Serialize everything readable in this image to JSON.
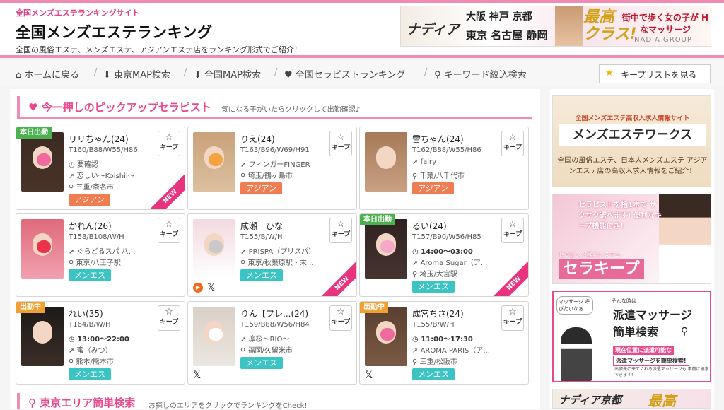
{
  "header": {
    "tagline": "全国メンズエステランキングサイト",
    "title": "全国メンズエステランキング",
    "description": "全国の風俗エステ、メンズエステ、アジアンエステ店をランキング形式でご紹介！"
  },
  "top_banner": {
    "brand": "ナディア",
    "cities_line1": "大阪 神戸 京都",
    "cities_line2": "東京 名古屋 静岡",
    "saiko": "最高",
    "class": "クラス!",
    "copy": "街中で歩く女の子が Hなマッサージ",
    "group": "NADIA GROUP"
  },
  "nav": {
    "items": [
      {
        "icon": "home-icon",
        "label": "ホームに戻る"
      },
      {
        "icon": "download-arrow-icon",
        "label": "東京MAP検索"
      },
      {
        "icon": "download-arrow-icon",
        "label": "全国MAP検索"
      },
      {
        "icon": "heart-icon",
        "label": "全国セラピストランキング"
      },
      {
        "icon": "search-icon",
        "label": "キーワード絞込検索"
      }
    ],
    "keeplist_label": "キープリストを見る"
  },
  "pickup": {
    "title": "今一押しのピックアップセラピスト",
    "subtitle": "気になる子がいたらクリックして出勤確認♪",
    "keep_label": "キープ",
    "new_label": "NEW",
    "cards": [
      {
        "badge": "本日出勤",
        "badge_type": "today",
        "name": "リリちゃん",
        "age": "(24)",
        "size": "T160/B88/W55/H86",
        "time": "要確認",
        "shop": "恋しい〜Koishii〜",
        "area": "三重/斎名市",
        "tag": "アジアン",
        "tag_type": "asian",
        "is_new": true,
        "sns": ""
      },
      {
        "badge": "",
        "badge_type": "",
        "name": "りえ",
        "age": "(24)",
        "size": "T163/B96/W69/H91",
        "time": "",
        "shop": "フィンガーFINGER",
        "area": "埼玉/鶴ヶ島市",
        "tag": "アジアン",
        "tag_type": "asian",
        "is_new": false,
        "sns": ""
      },
      {
        "badge": "",
        "badge_type": "",
        "name": "雪ちゃん",
        "age": "(24)",
        "size": "T162/B88/W55/H86",
        "time": "",
        "shop": "fairy",
        "area": "千葉/八千代市",
        "tag": "アジアン",
        "tag_type": "asian",
        "is_new": false,
        "sns": ""
      },
      {
        "badge": "",
        "badge_type": "",
        "name": "かれん",
        "age": "(26)",
        "size": "T158/B108/W/H",
        "time": "",
        "shop": "ぐらどるスパ 八...",
        "area": "東京/八王子駅",
        "tag": "メンエス",
        "tag_type": "mens",
        "is_new": false,
        "sns": ""
      },
      {
        "badge": "",
        "badge_type": "",
        "name": "成瀬　ひな",
        "age": "",
        "size": "T155/B/W/H",
        "time": "",
        "shop": "PRISPA（プリスパ）",
        "area": "東京/秋葉原駅・末...",
        "tag": "メンエス",
        "tag_type": "mens",
        "is_new": true,
        "sns": "▶ 𝕏"
      },
      {
        "badge": "本日出勤",
        "badge_type": "today",
        "name": "るい",
        "age": "(24)",
        "size": "T157/B90/W56/H85",
        "time": "14:00〜03:00",
        "shop": "Aroma Sugar（ア...",
        "area": "埼玉/大宮駅",
        "tag": "メンエス",
        "tag_type": "mens",
        "is_new": true,
        "sns": ""
      },
      {
        "badge": "出勤中",
        "badge_type": "work",
        "name": "れい",
        "age": "(35)",
        "size": "T164/B/W/H",
        "time": "13:00〜22:00",
        "shop": "蜜（みつ）",
        "area": "熊本/熊本市",
        "tag": "メンエス",
        "tag_type": "mens",
        "is_new": false,
        "sns": ""
      },
      {
        "badge": "",
        "badge_type": "",
        "name": "りん【プレ...",
        "age": "(24)",
        "size": "T159/B88/W56/H84",
        "time": "",
        "shop": "凛桜〜RIO〜",
        "area": "福岡/久留米市",
        "tag": "メンエス",
        "tag_type": "mens",
        "is_new": false,
        "sns": "𝕏"
      },
      {
        "badge": "出勤中",
        "badge_type": "work",
        "name": "成宮ちさ",
        "age": "(24)",
        "size": "T155/B/W/H",
        "time": "11:00〜17:30",
        "shop": "AROMA PARIS（ア...",
        "area": "三重/松阪市",
        "tag": "メンエス",
        "tag_type": "mens",
        "is_new": false,
        "sns": "𝕏"
      }
    ]
  },
  "area_search": {
    "title": "東京エリア簡単検索",
    "subtitle": "お探しのエリアをクリックでランキングをCheck!"
  },
  "sidebar": {
    "recruit": {
      "small": "全国メンズエステ高収入求人情報サイト",
      "big": "メンズエステワークス",
      "desc": "全国の風俗エステ、日本人メンズエステ アジアンエステ店の高収入求人情報をご紹介！"
    },
    "serakeep": {
      "text": "セラピストを指1本で サクサク選べます! 便利なキープ機能付き!",
      "small": "セラピスト検索システム",
      "title": "セラキープ"
    },
    "dispatch": {
      "bubble": "マッサージ 呼びたいなぁ…",
      "small": "そんな時は",
      "title1": "派遣マッサージ",
      "title2": "簡単検索",
      "pill1": "現在位置に派遣可能な",
      "pill2": "派遣マッサージを簡単検索!",
      "note": "出張先に来てくれる派遣マッサージも 事前に検索できます!"
    },
    "nadia_kyoto": {
      "title": "ナディア京都",
      "saiko": "最高"
    }
  }
}
